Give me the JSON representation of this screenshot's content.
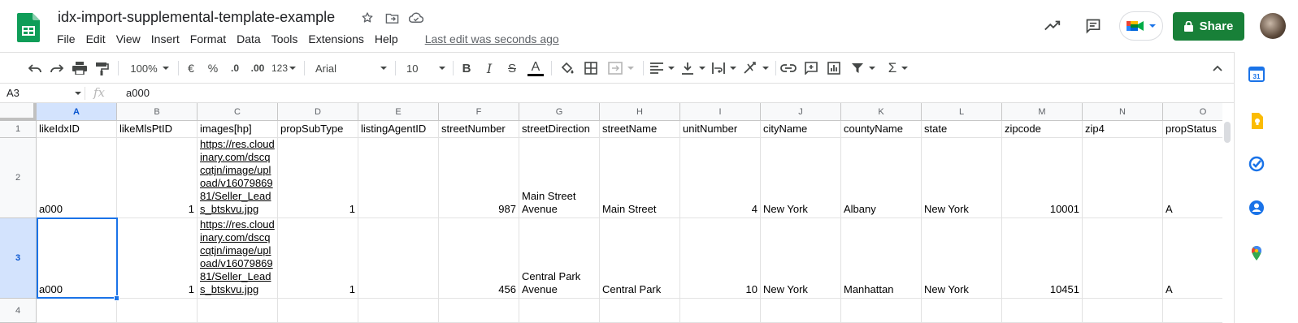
{
  "header": {
    "title": "idx-import-supplemental-template-example",
    "menu": [
      "File",
      "Edit",
      "View",
      "Insert",
      "Format",
      "Data",
      "Tools",
      "Extensions",
      "Help"
    ],
    "last_edit": "Last edit was seconds ago",
    "share_label": "Share"
  },
  "toolbar": {
    "zoom": "100%",
    "currency": "€",
    "percent": "%",
    "dec_decrease": ".0",
    "dec_increase": ".00",
    "more_formats": "123",
    "font": "Arial",
    "font_size": "10",
    "bold": "B",
    "italic": "I",
    "strike": "S",
    "text_color": "A"
  },
  "formula_bar": {
    "cell_ref": "A3",
    "fx": "fx",
    "value": "a000"
  },
  "grid": {
    "columns": [
      "A",
      "B",
      "C",
      "D",
      "E",
      "F",
      "G",
      "H",
      "I",
      "J",
      "K",
      "L",
      "M",
      "N",
      "O"
    ],
    "rows": [
      "1",
      "2",
      "3",
      "4"
    ],
    "selected_cell": "A3",
    "headers": [
      "likeIdxID",
      "likeMlsPtID",
      "images[hp]",
      "propSubType",
      "listingAgentID",
      "streetNumber",
      "streetDirection",
      "streetName",
      "unitNumber",
      "cityName",
      "countyName",
      "state",
      "zipcode",
      "zip4",
      "propStatus"
    ],
    "data": [
      [
        "a000",
        "1",
        "https://res.cloudinary.com/dscqcqtjn/image/upload/v1607986981/Seller_Leads_btskvu.jpg",
        "1",
        "",
        "987",
        "Main Street Avenue",
        "Main Street",
        "4",
        "New York",
        "Albany",
        "New York",
        "10001",
        "",
        "A"
      ],
      [
        "a000",
        "1",
        "https://res.cloudinary.com/dscqcqtjn/image/upload/v1607986981/Seller_Leads_btskvu.jpg",
        "1",
        "",
        "456",
        "Central Park Avenue",
        "Central Park",
        "10",
        "New York",
        "Manhattan",
        "New York",
        "10451",
        "",
        "A"
      ]
    ]
  },
  "colors": {
    "share": "#188038",
    "selection": "#1a73e8",
    "header_bg": "#f8f9fa"
  },
  "icons": [
    "sheets-logo",
    "star-icon",
    "move-icon",
    "cloud-status-icon",
    "trending-icon",
    "comment-icon",
    "meet-icon",
    "lock-icon",
    "undo-icon",
    "redo-icon",
    "print-icon",
    "paint-format-icon",
    "fill-color-icon",
    "borders-icon",
    "merge-icon",
    "align-icon",
    "valign-icon",
    "wrap-icon",
    "rotate-icon",
    "link-icon",
    "insert-comment-icon",
    "chart-icon",
    "filter-icon",
    "functions-icon",
    "collapse-icon",
    "calendar-icon",
    "keep-icon",
    "tasks-icon",
    "contacts-icon",
    "maps-icon"
  ]
}
